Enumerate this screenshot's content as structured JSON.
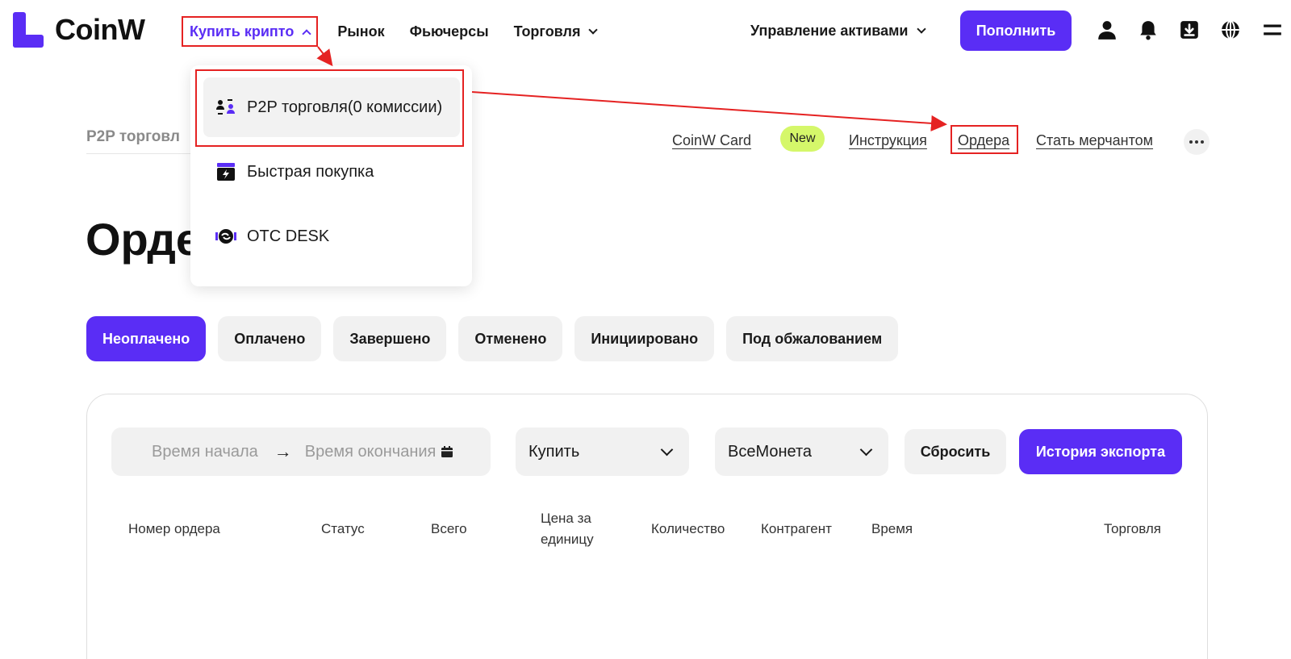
{
  "header": {
    "logo_text": "CoinW",
    "nav": {
      "buy_crypto": "Купить крипто",
      "market": "Рынок",
      "futures": "Фьючерсы",
      "trade": "Торговля"
    },
    "asset_management": "Управление активами",
    "deposit_label": "Пополнить",
    "icons": [
      "user-icon",
      "bell-icon",
      "download-icon",
      "globe-icon",
      "menu-icon"
    ]
  },
  "dropdown": {
    "items": [
      {
        "label": "P2P торговля(0 комиссии)",
        "icon": "p2p-icon"
      },
      {
        "label": "Быстрая покупка",
        "icon": "quick-buy-icon"
      },
      {
        "label": "OTC DESK",
        "icon": "otc-icon"
      }
    ]
  },
  "subheader": {
    "breadcrumb": "P2P торговл",
    "links": {
      "card": "CoinW Card",
      "new_badge": "New",
      "instructions": "Инструкция",
      "orders": "Ордера",
      "merchant": "Стать мерчантом"
    }
  },
  "page": {
    "title": "Орде"
  },
  "tabs": [
    "Неоплачено",
    "Оплачено",
    "Завершено",
    "Отменено",
    "Инициировано",
    "Под обжалованием"
  ],
  "filters": {
    "start_placeholder": "Время начала",
    "end_placeholder": "Время окончания",
    "side": "Купить",
    "coin": "ВсеМонета",
    "reset": "Сбросить",
    "export": "История экспорта"
  },
  "table": {
    "columns": [
      "Номер ордера",
      "Статус",
      "Всего",
      "Цена за единицу",
      "Количество",
      "Контрагент",
      "Время",
      "Торговля"
    ]
  },
  "colors": {
    "accent": "#5a2df5",
    "annotation": "#e52222",
    "badge": "#d5f76a"
  }
}
